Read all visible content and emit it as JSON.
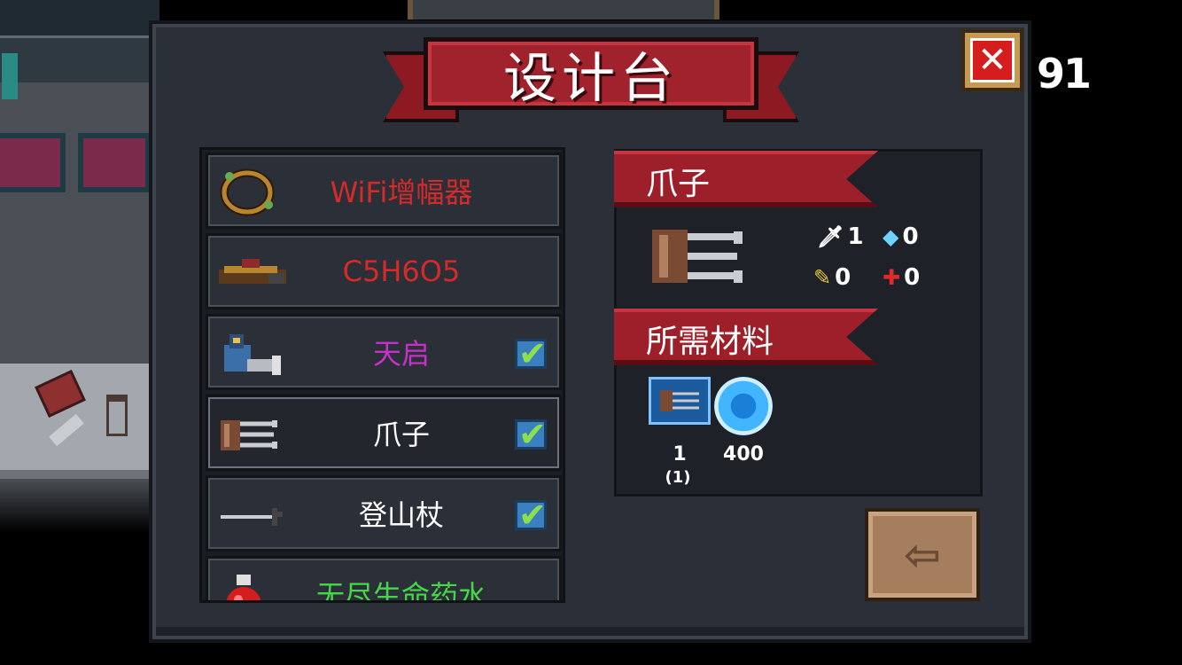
{
  "title": "设计台",
  "currency": {
    "count": "91"
  },
  "close_button": {
    "icon": "close-icon",
    "symbol": "✕"
  },
  "recipes": [
    {
      "name": "WiFi增幅器",
      "color": "#d52a2a",
      "icon": "wifi-amplifier-icon",
      "unlocked": false
    },
    {
      "name": "C5H6O5",
      "color": "#d52a2a",
      "icon": "c5h6o5-icon",
      "unlocked": false
    },
    {
      "name": "天启",
      "color": "#c531c9",
      "icon": "apocalypse-icon",
      "unlocked": true
    },
    {
      "name": "爪子",
      "color": "#ffffff",
      "icon": "claw-icon",
      "unlocked": true,
      "selected": true
    },
    {
      "name": "登山杖",
      "color": "#ffffff",
      "icon": "trekking-pole-icon",
      "unlocked": true
    },
    {
      "name": "无尽生命药水",
      "color": "#47d64a",
      "icon": "endless-life-potion-icon",
      "unlocked": false
    }
  ],
  "detail": {
    "item_name": "爪子",
    "stats": [
      {
        "icon": "sword-icon",
        "glyph": "🗡",
        "value": "1"
      },
      {
        "icon": "diamond-icon",
        "glyph": "◆",
        "value": "0"
      },
      {
        "icon": "crit-feather-icon",
        "glyph": "✎",
        "value": "0"
      },
      {
        "icon": "precision-cross-icon",
        "glyph": "✚",
        "value": "0"
      }
    ],
    "materials_title": "所需材料",
    "materials": [
      {
        "icon": "claw-blueprint-icon",
        "count": "1",
        "owned": "(1)"
      },
      {
        "icon": "blue-gem-icon",
        "count": "400"
      }
    ]
  },
  "exit_button": {
    "icon": "exit-icon",
    "symbol": "⇦"
  }
}
